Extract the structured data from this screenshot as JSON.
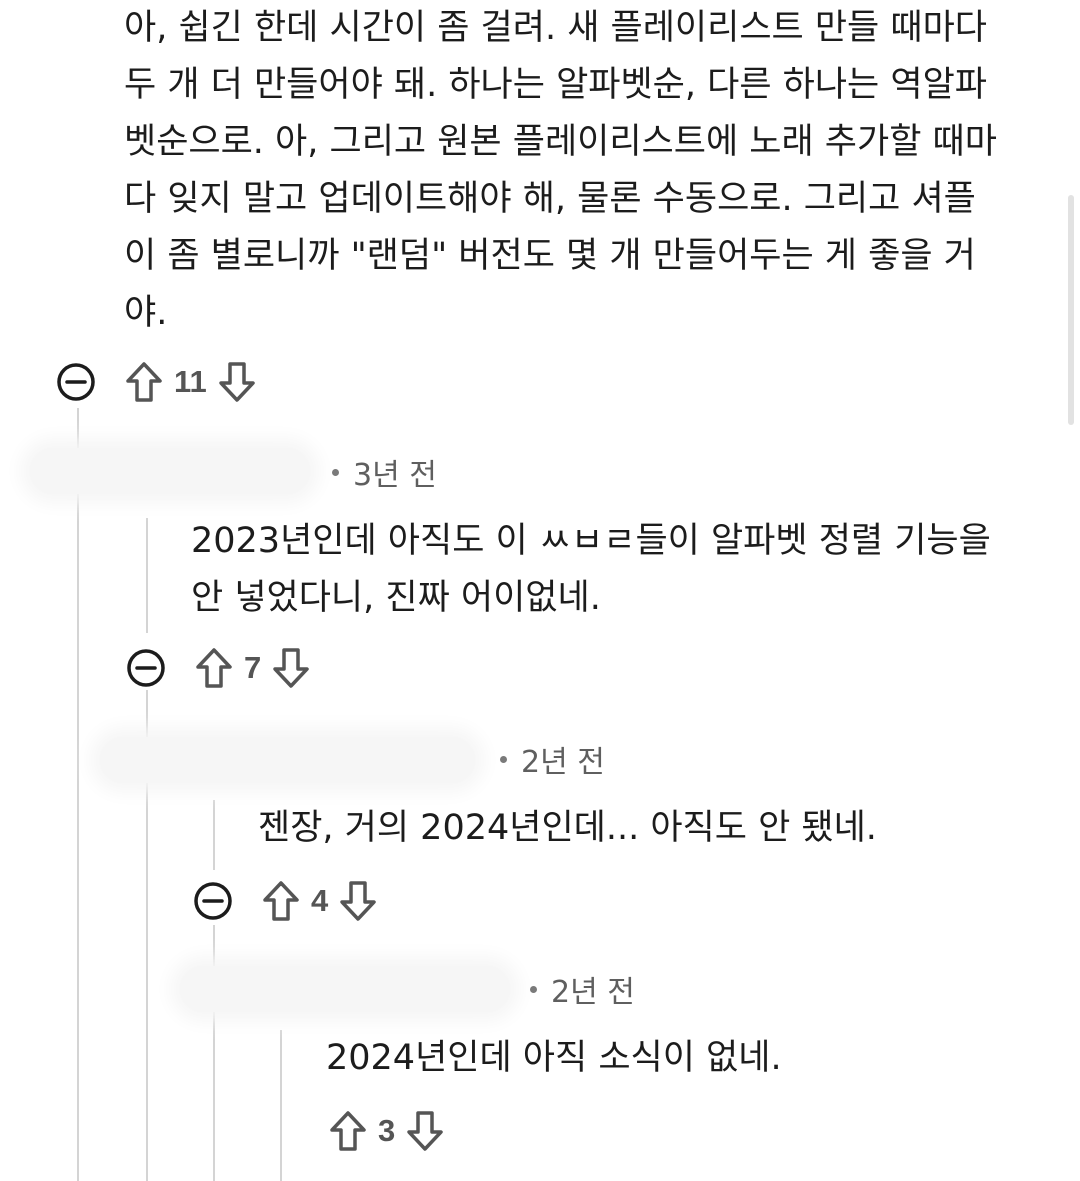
{
  "comments": [
    {
      "body": "아, 쉽긴 한데 시간이 좀 걸려. 새 플레이리스트 만들 때마다\n두 개 더 만들어야 돼. 하나는 알파벳순, 다른 하나는 역알파\n벳순으로. 아, 그리고 원본 플레이리스트에 노래 추가할 때마\n다 잊지 말고 업데이트해야 해, 물론 수동으로. 그리고 셔플\n이 좀 별로니까 \"랜덤\" 버전도 몇 개 만들어두는 게 좋을 거\n야.",
      "score": "11"
    },
    {
      "time": "3년 전",
      "body": "2023년인데 아직도 이 ㅆㅂㄹ들이 알파벳 정렬 기능을\n안 넣었다니, 진짜 어이없네.",
      "score": "7"
    },
    {
      "time": "2년 전",
      "body": "젠장, 거의 2024년인데... 아직도 안 됐네.",
      "score": "4"
    },
    {
      "time": "2년 전",
      "body": "2024년인데 아직 소식이 없네.",
      "score": "3"
    }
  ],
  "icons": {
    "collapse": "minus-circle-icon",
    "upvote": "arrow-up-icon",
    "downvote": "arrow-down-icon"
  },
  "colors": {
    "text": "#1c1c1c",
    "meta": "#5f5f5f",
    "thread_line": "#d4d4d4"
  }
}
